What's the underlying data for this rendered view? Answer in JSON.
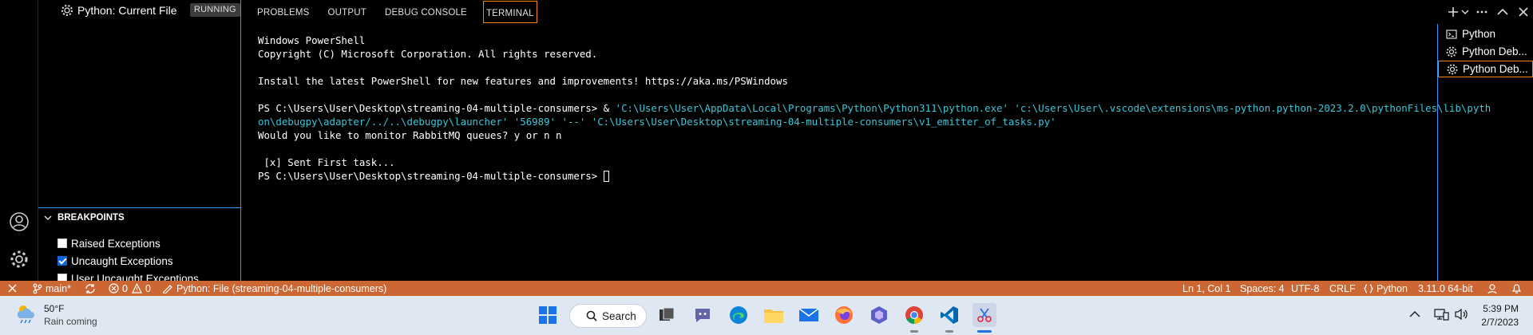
{
  "sidebar": {
    "run_item_label": "Python: Current File",
    "run_status": "RUNNING",
    "breakpoints_header": "BREAKPOINTS",
    "breakpoints": [
      {
        "label": "Raised Exceptions",
        "checked": false
      },
      {
        "label": "Uncaught Exceptions",
        "checked": true
      },
      {
        "label": "User Uncaught Exceptions",
        "checked": false
      }
    ]
  },
  "panel": {
    "tabs": [
      "PROBLEMS",
      "OUTPUT",
      "DEBUG CONSOLE",
      "TERMINAL"
    ],
    "active_tab": "TERMINAL"
  },
  "terminal": {
    "lines": [
      "Windows PowerShell",
      "Copyright (C) Microsoft Corporation. All rights reserved.",
      "",
      "Install the latest PowerShell for new features and improvements! https://aka.ms/PSWindows",
      ""
    ],
    "prompt_1": "PS C:\\Users\\User\\Desktop\\streaming-04-multiple-consumers>",
    "command_amp": " & ",
    "command_1a": "'C:\\Users\\User\\AppData\\Local\\Programs\\Python\\Python311\\python.exe' 'c:\\Users\\User\\.vscode\\extensions\\ms-python.python-2023.2.0\\pythonFiles\\lib\\pyth",
    "command_1b": "on\\debugpy\\adapter/../..\\debugpy\\launcher' '56989' '--' 'C:\\Users\\User\\Desktop\\streaming-04-multiple-consumers\\v1_emitter_of_tasks.py'",
    "output_1": "Would you like to monitor RabbitMQ queues? y or n n",
    "output_2": "",
    "output_3": " [x] Sent First task...",
    "prompt_2": "PS C:\\Users\\User\\Desktop\\streaming-04-multiple-consumers> "
  },
  "terminal_list": [
    {
      "label": "Python",
      "icon": "terminal-icon",
      "active": false
    },
    {
      "label": "Python Deb...",
      "icon": "debug-icon",
      "active": false
    },
    {
      "label": "Python Deb...",
      "icon": "debug-icon",
      "active": true
    }
  ],
  "statusbar": {
    "branch": "main*",
    "errors": "0",
    "warnings": "0",
    "debug_target": "Python: File (streaming-04-multiple-consumers)",
    "cursor_pos": "Ln 1, Col 1",
    "spaces": "Spaces: 4",
    "encoding": "UTF-8",
    "eol": "CRLF",
    "language": "Python",
    "interpreter": "3.11.0 64-bit",
    "bg_color": "#cc6633"
  },
  "taskbar": {
    "weather_temp": "50°F",
    "weather_desc": "Rain coming",
    "search_label": "Search",
    "time": "5:39 PM",
    "date": "2/7/2023"
  }
}
